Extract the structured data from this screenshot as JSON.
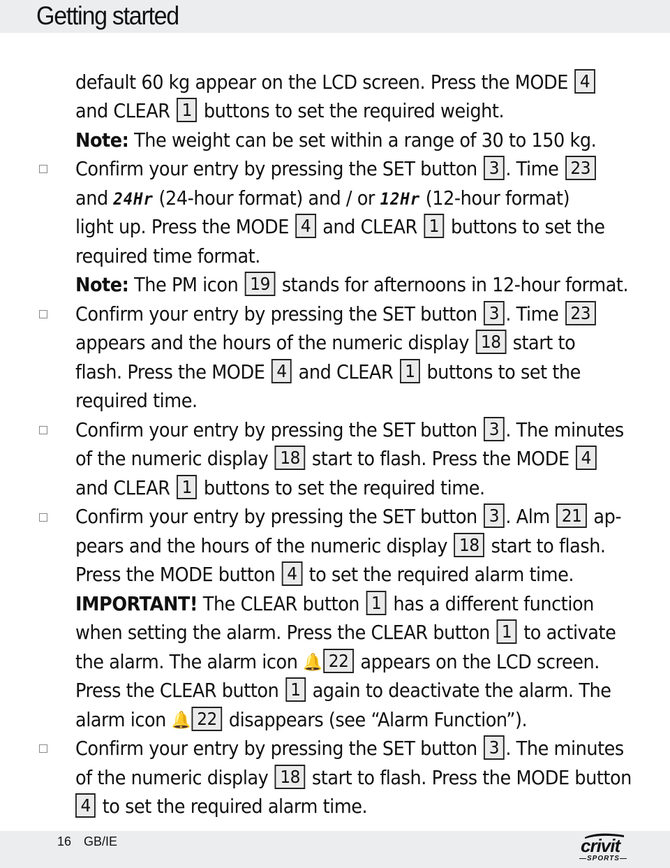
{
  "header": {
    "title": "Getting started"
  },
  "lines": [
    {
      "segs": [
        "default 60 kg appear on the LCD screen. Press the MODE ",
        "4",
        ""
      ]
    },
    {
      "segs": [
        "and CLEAR ",
        "1",
        " buttons to set the required weight."
      ]
    },
    {
      "segs": [
        "Note:",
        " The weight can be set within a range of 30 to 150 kg."
      ]
    },
    {
      "segs": [
        "Confirm your entry by pressing the SET button ",
        "3",
        ". Time ",
        "23"
      ]
    },
    {
      "segs": [
        "and ",
        "24Hr",
        " (24-hour format) and / or ",
        "12Hr",
        " (12-hour format)"
      ]
    },
    {
      "segs": [
        "light up. Press the MODE ",
        "4",
        " and CLEAR ",
        "1",
        " buttons to set the"
      ]
    },
    {
      "segs": [
        "required time format."
      ]
    },
    {
      "segs": [
        "Note:",
        " The PM icon ",
        "19",
        " stands for afternoons in 12-hour format."
      ]
    },
    {
      "segs": [
        "Confirm your entry by pressing the SET button ",
        "3",
        ". Time ",
        "23"
      ]
    },
    {
      "segs": [
        "appears and the hours of the numeric display ",
        "18",
        " start to"
      ]
    },
    {
      "segs": [
        "flash. Press the MODE ",
        "4",
        " and CLEAR ",
        "1",
        " buttons to set the"
      ]
    },
    {
      "segs": [
        "required time."
      ]
    },
    {
      "segs": [
        "Confirm your entry by pressing the SET button ",
        "3",
        ". The minutes"
      ]
    },
    {
      "segs": [
        "of the numeric display ",
        "18",
        " start to flash. Press the MODE ",
        "4"
      ]
    },
    {
      "segs": [
        "and CLEAR ",
        "1",
        " buttons to set the required time."
      ]
    },
    {
      "segs": [
        "Confirm your entry by pressing the SET button ",
        "3",
        ". Alm ",
        "21",
        " ap-"
      ]
    },
    {
      "segs": [
        "pears and the hours of the numeric display ",
        "18",
        " start to flash."
      ]
    },
    {
      "segs": [
        "Press the MODE button ",
        "4",
        " to set the required alarm time."
      ]
    },
    {
      "segs": [
        "IMPORTANT!",
        " The CLEAR button ",
        "1",
        " has a different function"
      ]
    },
    {
      "segs": [
        "when setting the alarm. Press the CLEAR button ",
        "1",
        " to activate"
      ]
    },
    {
      "segs": [
        "the alarm. The alarm icon ",
        "22",
        " appears on the LCD screen."
      ]
    },
    {
      "segs": [
        "Press the CLEAR button ",
        "1",
        " again to deactivate the alarm. The"
      ]
    },
    {
      "segs": [
        "alarm icon ",
        "22",
        " disappears (see “Alarm Function”)."
      ]
    },
    {
      "segs": [
        "Confirm your entry by pressing the SET button ",
        "3",
        ". The minutes"
      ]
    },
    {
      "segs": [
        "of the numeric display ",
        "18",
        " start to flash. Press the MODE button"
      ]
    },
    {
      "segs": [
        "4",
        " to set the required alarm time."
      ]
    }
  ],
  "icons": {
    "bell": "🔔",
    "bullet": "checkbox-square"
  },
  "footer": {
    "page_number": "16",
    "locale": "GB/IE",
    "logo_main": "crivit",
    "logo_sub": "—SPORTS—"
  }
}
